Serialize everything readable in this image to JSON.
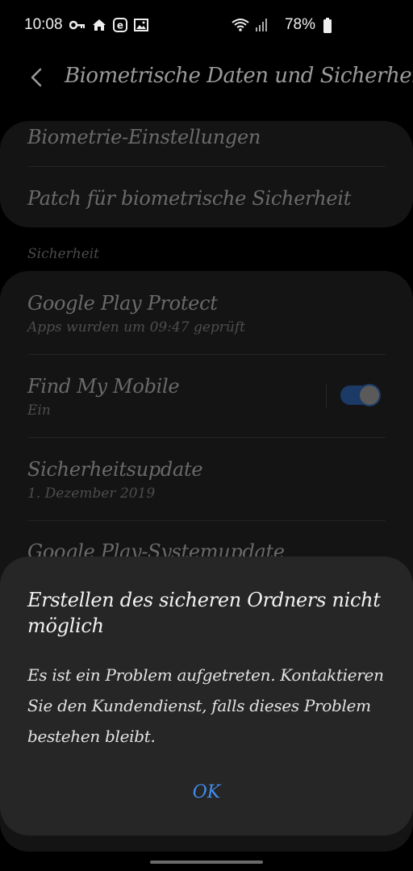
{
  "status_bar": {
    "time": "10:08",
    "battery": "78%",
    "left_icons": [
      "key-icon",
      "home-icon",
      "e-app-icon",
      "image-icon"
    ],
    "right_icons": [
      "wifi-icon",
      "signal-icon",
      "battery-icon"
    ]
  },
  "header": {
    "title": "Biometrische Daten und Sicherheit"
  },
  "biometric_card": {
    "items": [
      {
        "title": "Biometrie-Einstellungen"
      },
      {
        "title": "Patch für biometrische Sicherheit"
      }
    ]
  },
  "security_section": {
    "label": "Sicherheit",
    "items": [
      {
        "title": "Google Play Protect",
        "subtitle": "Apps wurden um 09:47 geprüft"
      },
      {
        "title": "Find My Mobile",
        "subtitle": "Ein",
        "toggle": true
      },
      {
        "title": "Sicherheitsupdate",
        "subtitle": "1. Dezember 2019"
      },
      {
        "title": "Google Play-Systemupdate"
      }
    ]
  },
  "dialog": {
    "title": "Erstellen des sicheren Ordners nicht möglich",
    "message": "Es ist ein Problem aufgetreten. Kontaktieren Sie den Kundendienst, falls dieses Problem bestehen bleibt.",
    "ok_label": "OK"
  },
  "colors": {
    "accent": "#3e8ef0",
    "dialog_bg": "#262626",
    "card_bg": "#141414"
  }
}
